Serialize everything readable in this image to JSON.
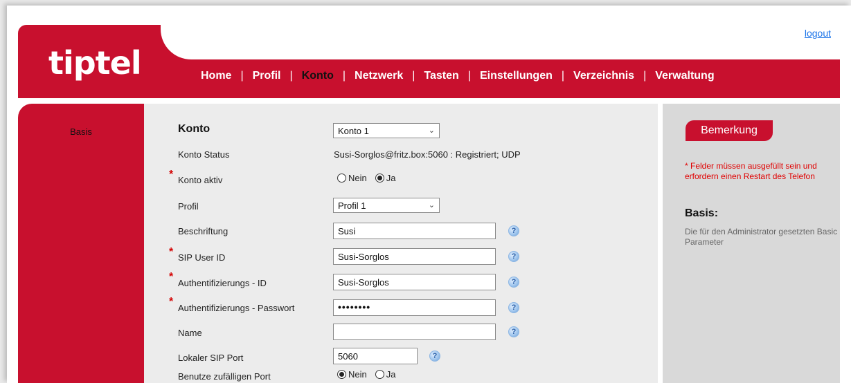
{
  "header": {
    "logo": "tiptel",
    "logout": "logout",
    "tabs": [
      {
        "label": "Home",
        "active": false
      },
      {
        "label": "Profil",
        "active": false
      },
      {
        "label": "Konto",
        "active": true
      },
      {
        "label": "Netzwerk",
        "active": false
      },
      {
        "label": "Tasten",
        "active": false
      },
      {
        "label": "Einstellungen",
        "active": false
      },
      {
        "label": "Verzeichnis",
        "active": false
      },
      {
        "label": "Verwaltung",
        "active": false
      }
    ],
    "separator": "|"
  },
  "sidebar": {
    "items": [
      {
        "label": "Basis"
      }
    ]
  },
  "form": {
    "title": "Konto",
    "konto_select": "Konto 1",
    "status_label": "Konto Status",
    "status_value": "Susi-Sorglos@fritz.box:5060 : Registriert; UDP",
    "aktiv_label": "Konto aktiv",
    "aktiv_options": [
      "Nein",
      "Ja"
    ],
    "aktiv_selected": "Ja",
    "profil_label": "Profil",
    "profil_select": "Profil 1",
    "beschriftung_label": "Beschriftung",
    "beschriftung_value": "Susi",
    "sip_user_label": "SIP User ID",
    "sip_user_value": "Susi-Sorglos",
    "auth_id_label": "Authentifizierungs - ID",
    "auth_id_value": "Susi-Sorglos",
    "auth_pwd_label": "Authentifizierungs - Passwort",
    "auth_pwd_value": "••••••••",
    "name_label": "Name",
    "name_value": "",
    "local_port_label": "Lokaler SIP Port",
    "local_port_value": "5060",
    "random_port_label": "Benutze zufälligen Port",
    "random_port_options": [
      "Nein",
      "Ja"
    ],
    "random_port_selected": "Nein",
    "required_marker": "*",
    "help_glyph": "?"
  },
  "notes": {
    "title": "Bemerkung",
    "required_note": "* Felder müssen ausgefüllt sein und erfordern einen Restart des Telefon",
    "section_title": "Basis:",
    "section_desc": "Die für den Administrator gesetzten Basic Parameter"
  },
  "colors": {
    "brand_red": "#c8102e",
    "link_blue": "#1a73e8",
    "note_red": "#e00000"
  }
}
